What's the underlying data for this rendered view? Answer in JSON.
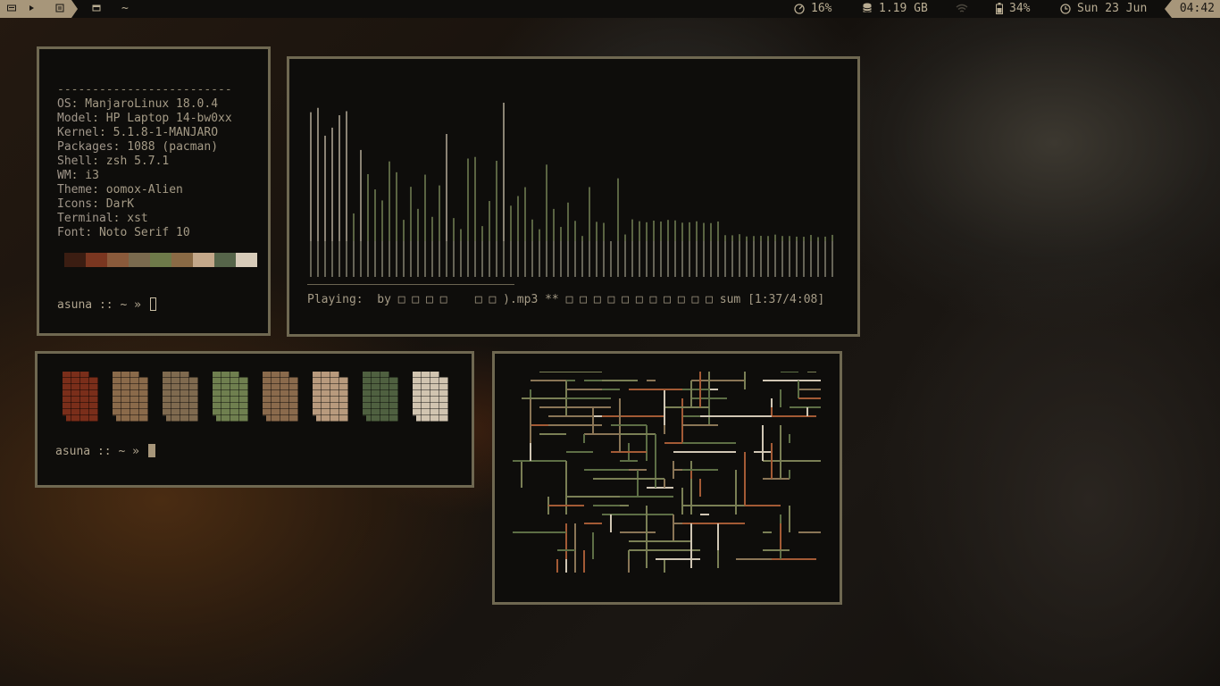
{
  "topbar": {
    "workspace_home": "~",
    "cpu": "16%",
    "memory": "1.19 GB",
    "battery": "34%",
    "date": "Sun 23 Jun",
    "time": "04:42"
  },
  "neofetch": {
    "separator": "-------------------------",
    "rows": [
      {
        "key": "OS",
        "value": "ManjaroLinux 18.0.4"
      },
      {
        "key": "Model",
        "value": "HP Laptop 14-bw0xx"
      },
      {
        "key": "Kernel",
        "value": "5.1.8-1-MANJARO"
      },
      {
        "key": "Packages",
        "value": "1088 (pacman)"
      },
      {
        "key": "Shell",
        "value": "zsh 5.7.1"
      },
      {
        "key": "WM",
        "value": "i3"
      },
      {
        "key": "Theme",
        "value": "oomox-Alien"
      },
      {
        "key": "Icons",
        "value": "DarK"
      },
      {
        "key": "Terminal",
        "value": "xst"
      },
      {
        "key": "Font",
        "value": "Noto Serif 10"
      }
    ],
    "palette": [
      "#3b1d12",
      "#7a3620",
      "#8a5a3b",
      "#7a6a4e",
      "#6e7a4a",
      "#8a6a45",
      "#c4a88a",
      "#56654a",
      "#d7cbb9"
    ],
    "prompt": "asuna :: ~ »"
  },
  "visualizer": {
    "status": "Playing:  by □ □ □ □    □ □ ).mp3 ** □ □ □ □ □ □ □ □ □ □ □ sum [1:37/4:08]",
    "bar_color": "#7b8a5a",
    "bar_color_low": "#8d8a78"
  },
  "colorblocks": {
    "colors": [
      "#7a2e1a",
      "#8a6a4a",
      "#7f6a4f",
      "#6f7f4f",
      "#8a6a4c",
      "#b89a7d",
      "#4f6040",
      "#d1c4b0"
    ],
    "prompt": "asuna :: ~ »"
  },
  "pipes": {
    "colors": [
      "#d0c6b4",
      "#7a7f55",
      "#a35a35",
      "#8a7556",
      "#5d6e45"
    ]
  }
}
